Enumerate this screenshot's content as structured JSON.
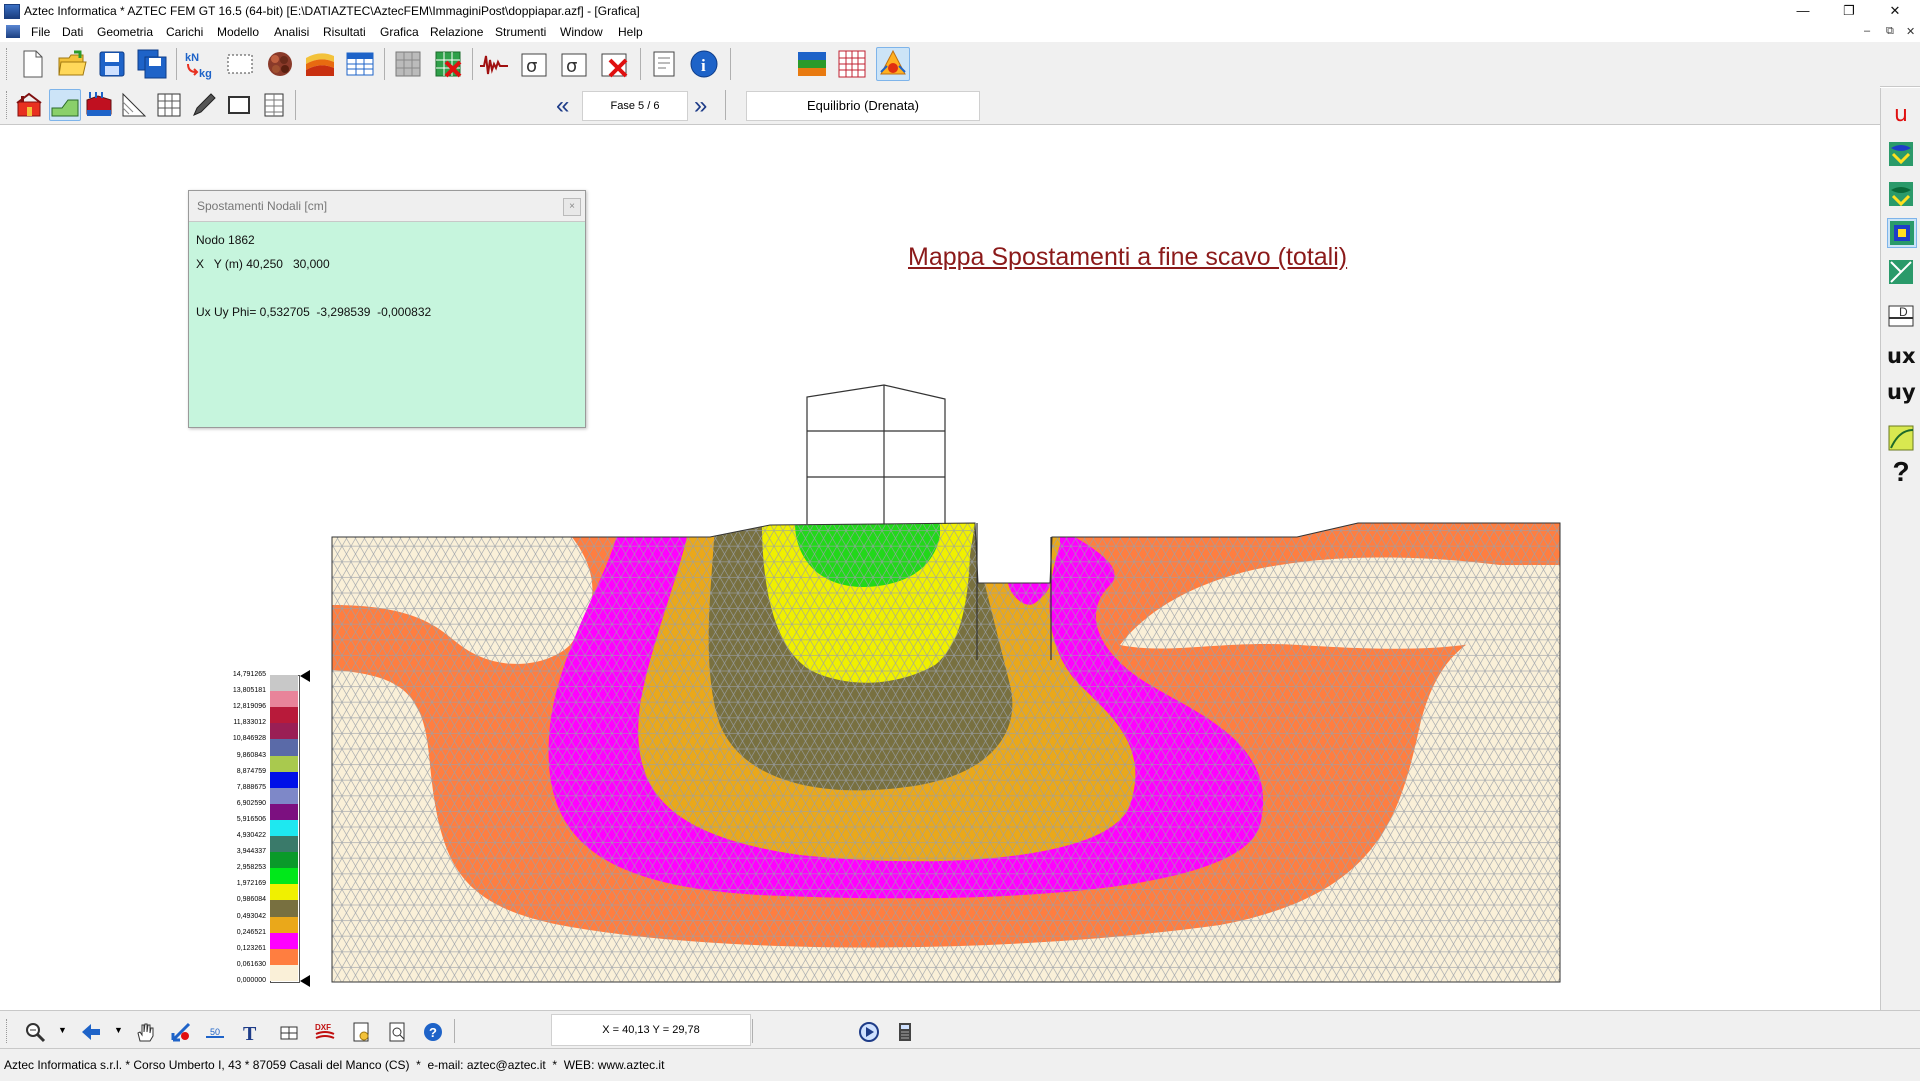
{
  "window": {
    "title": "Aztec Informatica * AZTEC FEM GT 16.5 (64-bit) [E:\\DATIAZTEC\\AztecFEM\\ImmaginiPost\\doppiapar.azf] - [Grafica]",
    "minimize": "—",
    "maximize": "❐",
    "close": "✕"
  },
  "menu": {
    "items": [
      "File",
      "Dati",
      "Geometria",
      "Carichi",
      "Modello",
      "Analisi",
      "Risultati",
      "Grafica",
      "Relazione",
      "Strumenti",
      "Window",
      "Help"
    ],
    "mdi_minimize": "–",
    "mdi_restore": "⧉",
    "mdi_close": "✕"
  },
  "toolbar": {
    "phase_label": "Fase 5 / 6",
    "prev_phase": "«",
    "next_phase": "»",
    "analysis_type": "Equilibrio (Drenata)",
    "icons": [
      "new-file-icon",
      "open-folder-icon",
      "save-icon",
      "save-all-icon",
      "units-icon",
      "select-rect-icon",
      "material-icon",
      "soil-layers-icon",
      "table-icon",
      "mesh-grey-icon",
      "mesh-delete-icon",
      "signal-icon",
      "sigma-x-icon",
      "sigma-2-icon",
      "sigma-delete-icon",
      "page-icon",
      "info-icon",
      "color-map-icon",
      "grid-icon",
      "fire-icon"
    ],
    "icons2": [
      "house-icon",
      "slope-icon",
      "loads-icon",
      "triangle-icon",
      "grid-mesh-icon",
      "pencil-icon",
      "frame-icon",
      "wall-icon"
    ]
  },
  "info_panel": {
    "title": "Spostamenti Nodali [cm]",
    "close": "×",
    "node": "Nodo 1862",
    "coords": "X   Y (m) 40,250   30,000",
    "values": "Ux Uy Phi= 0,532705  -3,298539  -0,000832"
  },
  "map_title": "Mappa Spostamenti a fine scavo (totali)",
  "legend": {
    "labels": [
      "14,791265",
      "13,805181",
      "12,819096",
      "11,833012",
      "10,846928",
      "9,860843",
      "8,874759",
      "7,888675",
      "6,902590",
      "5,916506",
      "4,930422",
      "3,944337",
      "2,958253",
      "1,972169",
      "0,986084",
      "0,493042",
      "0,246521",
      "0,123261",
      "0,061630",
      "0,000000"
    ],
    "colors": [
      "#c8c8c8",
      "#e8849a",
      "#b81a3a",
      "#9a1f55",
      "#5a6aa8",
      "#a9c94e",
      "#0010e8",
      "#7e88c8",
      "#7c1080",
      "#1ee8f0",
      "#3a7a6a",
      "#0a9a2a",
      "#00e81a",
      "#f0f000",
      "#787040",
      "#eaa81a",
      "#ff00ff",
      "#ff7e40",
      "#faf0d8"
    ]
  },
  "status": {
    "coordinates": "X = 40,13  Y = 29,78",
    "company": "Aztec Informatica s.r.l. * Corso Umberto I, 43 * 87059 Casali del Manco (CS)  *  e-mail: aztec@aztec.it  *  WEB: www.aztec.it"
  },
  "right_toolbar": {
    "u_label": "u",
    "ux_label": "ux",
    "uy_label": "uy",
    "help_label": "?"
  },
  "colors": {
    "soil_base": "#faf0d8",
    "orange": "#ff7e40",
    "magenta": "#ff00ff",
    "gold": "#eaa81a",
    "olive": "#787040",
    "yellow": "#f0f000",
    "green": "#22d81a",
    "title_red": "#8b1a1a",
    "panel_bg": "#c6f5dd"
  }
}
